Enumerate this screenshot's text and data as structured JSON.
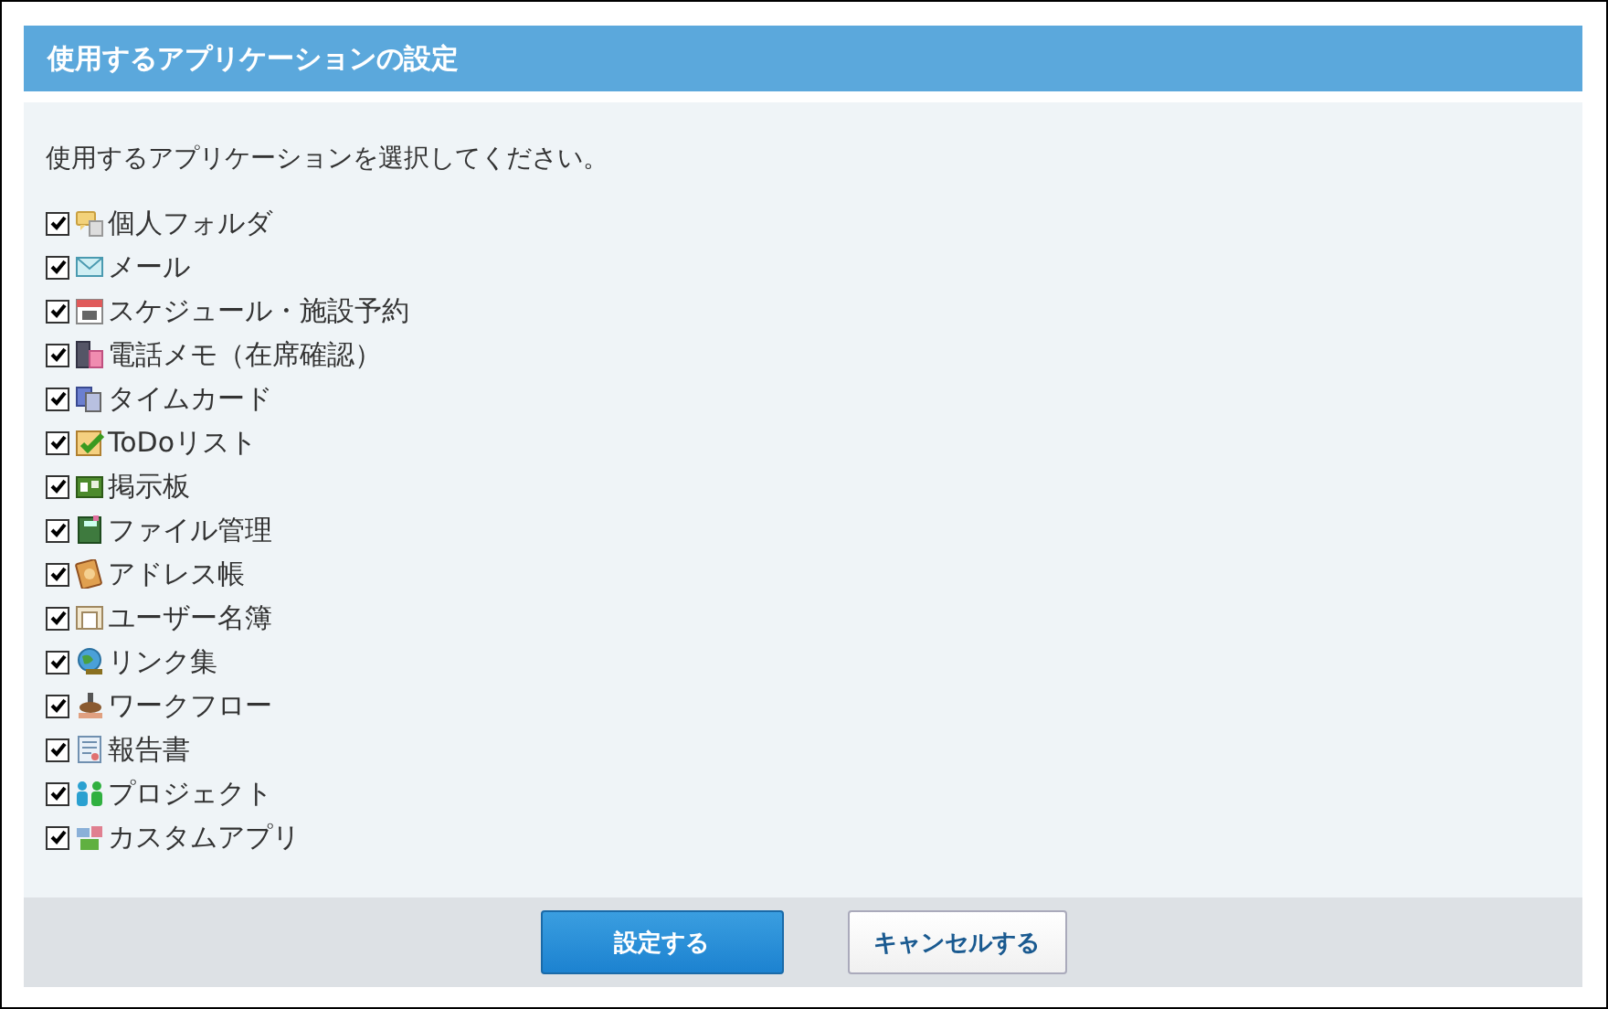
{
  "dialog": {
    "title": "使用するアプリケーションの設定",
    "instruction": "使用するアプリケーションを選択してください。"
  },
  "items": [
    {
      "label": "個人フォルダ",
      "checked": true
    },
    {
      "label": "メール",
      "checked": true
    },
    {
      "label": "スケジュール・施設予約",
      "checked": true
    },
    {
      "label": "電話メモ（在席確認）",
      "checked": true
    },
    {
      "label": "タイムカード",
      "checked": true
    },
    {
      "label": "ToDoリスト",
      "checked": true
    },
    {
      "label": "掲示板",
      "checked": true
    },
    {
      "label": "ファイル管理",
      "checked": true
    },
    {
      "label": "アドレス帳",
      "checked": true
    },
    {
      "label": "ユーザー名簿",
      "checked": true
    },
    {
      "label": "リンク集",
      "checked": true
    },
    {
      "label": "ワークフロー",
      "checked": true
    },
    {
      "label": "報告書",
      "checked": true
    },
    {
      "label": "プロジェクト",
      "checked": true
    },
    {
      "label": "カスタムアプリ",
      "checked": true
    }
  ],
  "buttons": [
    {
      "label": "設定する",
      "kind": "primary"
    },
    {
      "label": "キャンセルする",
      "kind": "secondary"
    }
  ]
}
